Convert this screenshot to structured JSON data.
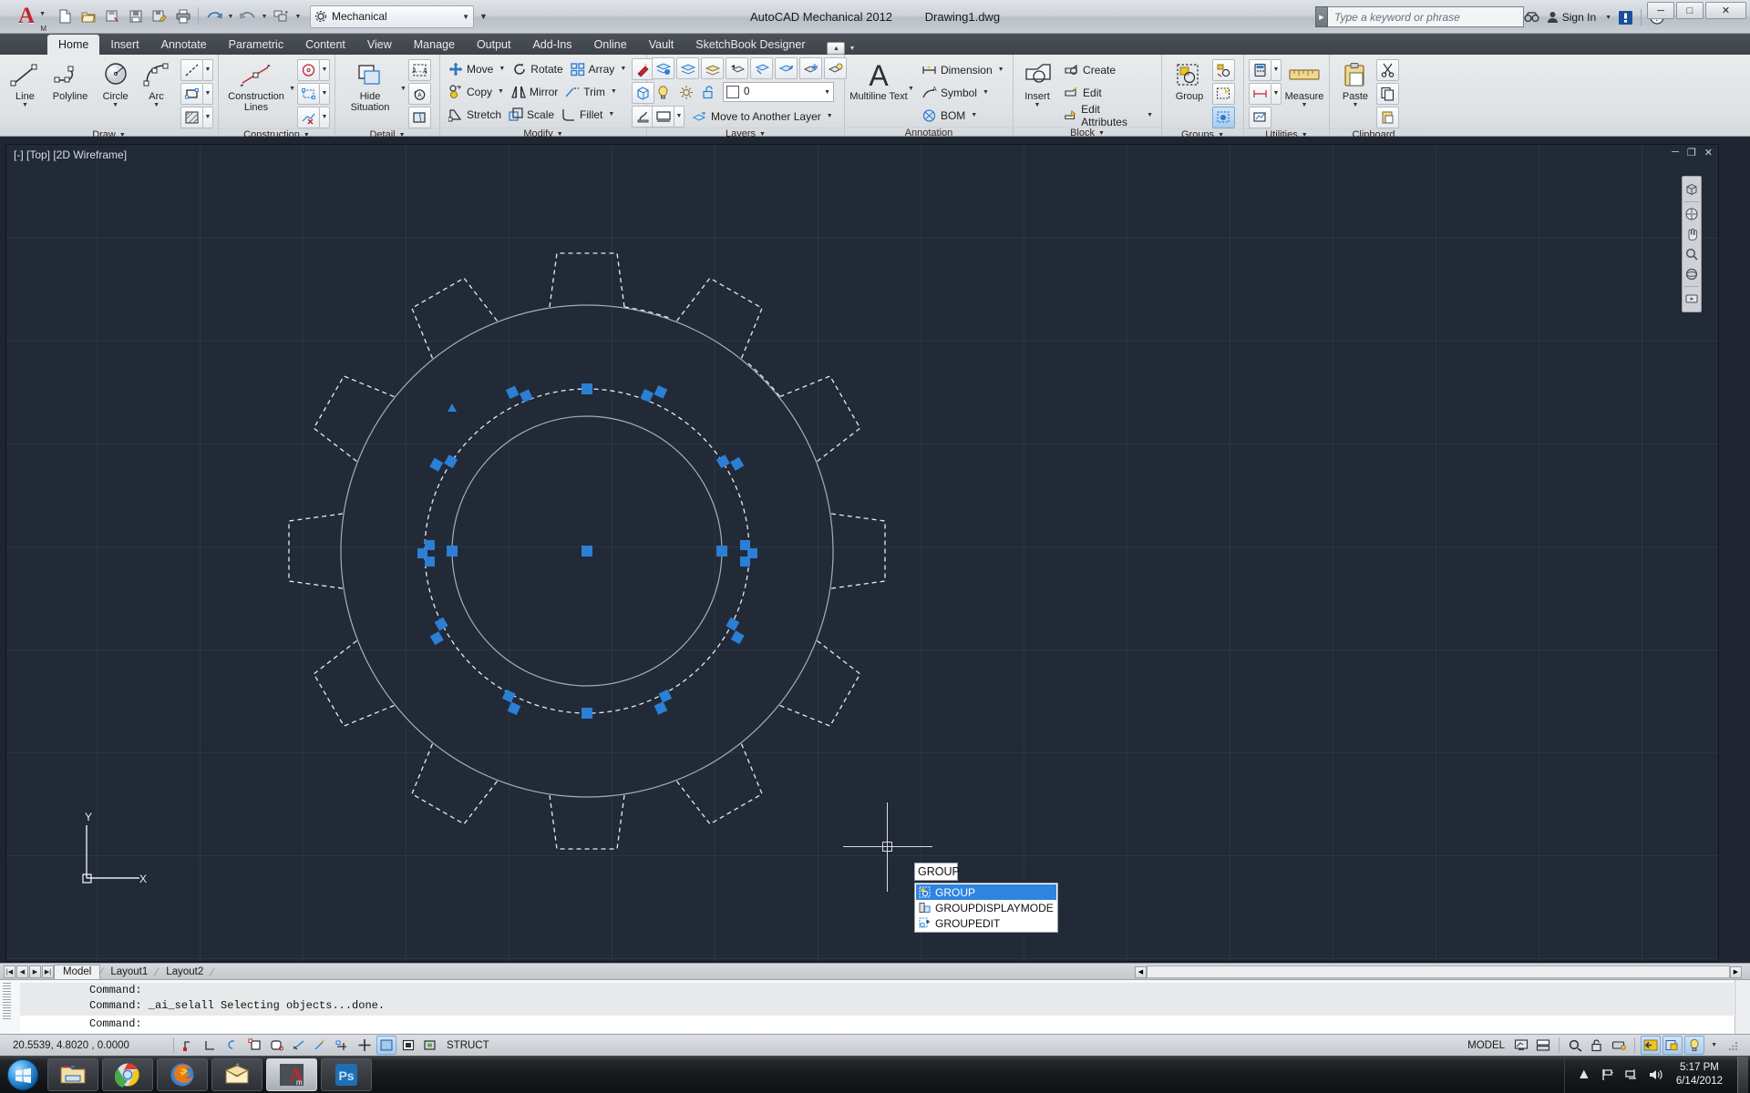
{
  "app": {
    "title": "AutoCAD Mechanical 2012",
    "document": "Drawing1.dwg",
    "logo_letter": "A",
    "logo_sub": "M"
  },
  "quick_access": {
    "items": [
      {
        "name": "new-icon",
        "tooltip": "New"
      },
      {
        "name": "open-icon",
        "tooltip": "Open"
      },
      {
        "name": "save-icon",
        "tooltip": "Save"
      },
      {
        "name": "saveas-icon",
        "tooltip": "Save As"
      },
      {
        "name": "plot-icon",
        "tooltip": "Plot"
      },
      {
        "name": "undo-icon",
        "tooltip": "Undo"
      },
      {
        "name": "redo-icon",
        "tooltip": "Redo"
      },
      {
        "name": "match-icon",
        "tooltip": "Match Properties"
      }
    ],
    "workspace": "Mechanical"
  },
  "infocenter": {
    "placeholder": "Type a keyword or phrase",
    "search_icon": "binoculars-icon",
    "signin_label": "Sign In",
    "exchange_icon": "autodesk-exchange-icon",
    "help_icon": "help-icon"
  },
  "window_controls": {
    "minimize": "─",
    "maximize": "□",
    "close": "✕"
  },
  "ribbon": {
    "tabs": [
      {
        "label": "Home",
        "active": true
      },
      {
        "label": "Insert",
        "active": false
      },
      {
        "label": "Annotate",
        "active": false
      },
      {
        "label": "Parametric",
        "active": false
      },
      {
        "label": "Content",
        "active": false
      },
      {
        "label": "View",
        "active": false
      },
      {
        "label": "Manage",
        "active": false
      },
      {
        "label": "Output",
        "active": false
      },
      {
        "label": "Add-Ins",
        "active": false
      },
      {
        "label": "Online",
        "active": false
      },
      {
        "label": "Vault",
        "active": false
      },
      {
        "label": "SketchBook Designer",
        "active": false
      }
    ],
    "panels": {
      "draw": {
        "title": "Draw",
        "big": [
          {
            "label": "Line",
            "icon": "line-icon",
            "has_dropdown": true
          },
          {
            "label": "Polyline",
            "icon": "polyline-icon",
            "has_dropdown": false
          },
          {
            "label": "Circle",
            "icon": "circle-icon",
            "has_dropdown": true
          },
          {
            "label": "Arc",
            "icon": "arc-icon",
            "has_dropdown": true
          }
        ],
        "small": [
          {
            "name": "construction-line-icon"
          },
          {
            "name": "rectangle-icon"
          },
          {
            "name": "hatch-icon"
          }
        ]
      },
      "construction": {
        "title": "Construction",
        "big": [
          {
            "label": "Construction Lines",
            "icon": "construction-lines-icon",
            "has_dropdown": true
          }
        ],
        "small": [
          {
            "name": "construction-circle-icon"
          },
          {
            "name": "construction-rectangle-icon"
          },
          {
            "name": "delete-construction-icon"
          }
        ]
      },
      "detail": {
        "title": "Detail",
        "big": [
          {
            "label": "Hide Situation",
            "icon": "hide-situation-icon",
            "has_dropdown": true
          }
        ],
        "small": [
          {
            "name": "detail-view-icon"
          },
          {
            "name": "rotate-detail-icon"
          },
          {
            "name": "break-out-icon"
          }
        ]
      },
      "modify": {
        "title": "Modify",
        "rows": [
          [
            {
              "label": "Move",
              "icon": "move-icon",
              "has_dropdown": true
            },
            {
              "label": "Rotate",
              "icon": "rotate-icon",
              "has_dropdown": false
            },
            {
              "label": "Array",
              "icon": "array-icon",
              "has_dropdown": true
            }
          ],
          [
            {
              "label": "Copy",
              "icon": "copy-icon",
              "has_dropdown": true
            },
            {
              "label": "Mirror",
              "icon": "mirror-icon",
              "has_dropdown": false
            },
            {
              "label": "Trim",
              "icon": "trim-icon",
              "has_dropdown": true
            }
          ],
          [
            {
              "label": "Stretch",
              "icon": "stretch-icon",
              "has_dropdown": false
            },
            {
              "label": "Scale",
              "icon": "scale-icon",
              "has_dropdown": false
            },
            {
              "label": "Fillet",
              "icon": "fillet-icon",
              "has_dropdown": true
            }
          ]
        ],
        "side": [
          {
            "name": "power-erase-icon"
          },
          {
            "name": "power-dimension-icon"
          },
          {
            "name": "power-snap-icon"
          }
        ]
      },
      "layers": {
        "title": "Layers",
        "top_icons": [
          {
            "name": "layer-properties-icon"
          },
          {
            "name": "layer-make-current-icon"
          },
          {
            "name": "layer-match-icon"
          },
          {
            "name": "layer-previous-icon"
          },
          {
            "name": "layer-isolate-icon"
          },
          {
            "name": "layer-unisolate-icon"
          },
          {
            "name": "layer-freeze-icon"
          },
          {
            "name": "layer-off-icon"
          }
        ],
        "status_icons": [
          {
            "name": "layer-bulb-icon"
          },
          {
            "name": "layer-sun-icon"
          },
          {
            "name": "layer-unlock-icon"
          }
        ],
        "current_layer": "0",
        "bottom": {
          "viewport_icon": "viewport-layer-icon",
          "move_label": "Move to Another Layer",
          "move_icon": "move-to-layer-icon"
        }
      },
      "annotation": {
        "title": "Annotation",
        "big": {
          "label": "Multiline Text",
          "icon": "multiline-text-icon",
          "glyph": "A",
          "has_dropdown": true
        },
        "items": [
          {
            "label": "Dimension",
            "icon": "dimension-icon",
            "has_dropdown": true
          },
          {
            "label": "Symbol",
            "icon": "symbol-icon",
            "has_dropdown": true
          },
          {
            "label": "BOM",
            "icon": "bom-icon",
            "has_dropdown": true
          }
        ]
      },
      "block": {
        "title": "Block",
        "big": {
          "label": "Insert",
          "icon": "insert-block-icon",
          "has_dropdown": true
        },
        "items": [
          {
            "label": "Create",
            "icon": "create-block-icon",
            "has_dropdown": false
          },
          {
            "label": "Edit",
            "icon": "edit-block-icon",
            "has_dropdown": false
          },
          {
            "label": "Edit Attributes",
            "icon": "edit-attributes-icon",
            "has_dropdown": true
          }
        ]
      },
      "groups": {
        "title": "Groups",
        "big": {
          "label": "Group",
          "icon": "group-icon"
        },
        "small": [
          {
            "name": "ungroup-icon"
          },
          {
            "name": "group-edit-icon"
          },
          {
            "name": "group-selection-on-off-icon"
          }
        ]
      },
      "utilities": {
        "title": "Utilities",
        "big": {
          "label": "Measure",
          "icon": "measure-icon"
        },
        "small": [
          {
            "name": "quick-calc-icon"
          },
          {
            "name": "distance-icon"
          },
          {
            "name": "id-point-icon"
          }
        ]
      },
      "clipboard": {
        "title": "Clipboard",
        "big": {
          "label": "Paste",
          "icon": "paste-icon",
          "has_dropdown": true
        },
        "small": [
          {
            "name": "cut-icon"
          },
          {
            "name": "copy-clip-icon"
          },
          {
            "name": "paste-special-icon"
          }
        ]
      }
    }
  },
  "viewport": {
    "label": "[-] [Top] [2D Wireframe]",
    "controls": {
      "minimize": "─",
      "restore": "❐",
      "close": "✕"
    },
    "ucs": {
      "x_label": "X",
      "y_label": "Y"
    },
    "navbar_icons": [
      {
        "name": "viewcube-icon"
      },
      {
        "name": "steering-wheel-icon"
      },
      {
        "name": "pan-icon"
      },
      {
        "name": "zoom-icon"
      },
      {
        "name": "orbit-icon"
      },
      {
        "name": "showmotion-icon"
      }
    ],
    "drawing": {
      "description": "Gear / sprocket with 12 teeth, dashed selection highlight and blue grip squares",
      "teeth": 12,
      "grip_color": "#2b7fd4",
      "dash_color": "#e8ebef",
      "solid_color": "#a6adb6"
    }
  },
  "command_autocomplete": {
    "typed": "GROUP",
    "options": [
      {
        "label": "GROUP",
        "icon": "group-cmd-icon",
        "selected": true
      },
      {
        "label": "GROUPDISPLAYMODE",
        "icon": "groupdisplaymode-cmd-icon",
        "selected": false
      },
      {
        "label": "GROUPEDIT",
        "icon": "groupedit-cmd-icon",
        "selected": false
      }
    ]
  },
  "layout_tabs": {
    "nav": [
      "◀▏",
      "◀",
      "▶",
      "▶▕"
    ],
    "tabs": [
      {
        "label": "Model",
        "active": true
      },
      {
        "label": "Layout1",
        "active": false
      },
      {
        "label": "Layout2",
        "active": false
      }
    ]
  },
  "command_window": {
    "history": [
      "Command:",
      "Command: _ai_selall Selecting objects...done."
    ],
    "current": "Command:"
  },
  "status_bar": {
    "coordinates": "20.5539, 4.8020 , 0.0000",
    "toggles": [
      {
        "name": "infer-constraints-icon",
        "on": false
      },
      {
        "name": "snap-mode-icon",
        "on": false
      },
      {
        "name": "grid-display-icon",
        "on": true
      },
      {
        "name": "ortho-mode-icon",
        "on": false
      },
      {
        "name": "polar-tracking-icon",
        "on": false
      },
      {
        "name": "object-snap-icon",
        "on": false
      },
      {
        "name": "osnap-tracking-icon",
        "on": false
      },
      {
        "name": "otrack-icon",
        "on": false
      },
      {
        "name": "dynamic-ucs-icon",
        "on": true
      },
      {
        "name": "dynamic-input-icon",
        "on": false
      },
      {
        "name": "lineweight-icon",
        "on": false
      }
    ],
    "struct_label": "STRUCT",
    "model_label": "MODEL",
    "right_icons": [
      {
        "name": "model-space-icon"
      },
      {
        "name": "quick-view-layouts-icon"
      },
      {
        "name": "annotation-scale-icon"
      },
      {
        "name": "annotation-visibility-icon"
      },
      {
        "name": "workspace-switch-icon"
      },
      {
        "name": "toolbar-lock-icon"
      },
      {
        "name": "hardware-accel-icon"
      },
      {
        "name": "isolate-objects-icon"
      },
      {
        "name": "clean-screen-icon"
      }
    ]
  },
  "taskbar": {
    "start": "windows-start-orb",
    "items": [
      {
        "name": "explorer-icon",
        "active": false
      },
      {
        "name": "chrome-icon",
        "active": false
      },
      {
        "name": "firefox-icon",
        "active": false
      },
      {
        "name": "mail-icon",
        "active": false
      },
      {
        "name": "autocad-mechanical-icon",
        "active": true
      },
      {
        "name": "photoshop-icon",
        "active": false,
        "label": "Ps"
      }
    ],
    "tray": [
      {
        "name": "show-hidden-icons-arrow"
      },
      {
        "name": "network-flag-icon"
      },
      {
        "name": "network-icon"
      },
      {
        "name": "volume-icon"
      }
    ],
    "clock_time": "5:17 PM",
    "clock_date": "6/14/2012"
  },
  "colors": {
    "accent_blue": "#2f84e0",
    "grip_blue": "#2b7fd4",
    "canvas_bg": "#222a38",
    "ribbon_bg": "#e5e8eb",
    "tab_bar": "#44494f"
  }
}
